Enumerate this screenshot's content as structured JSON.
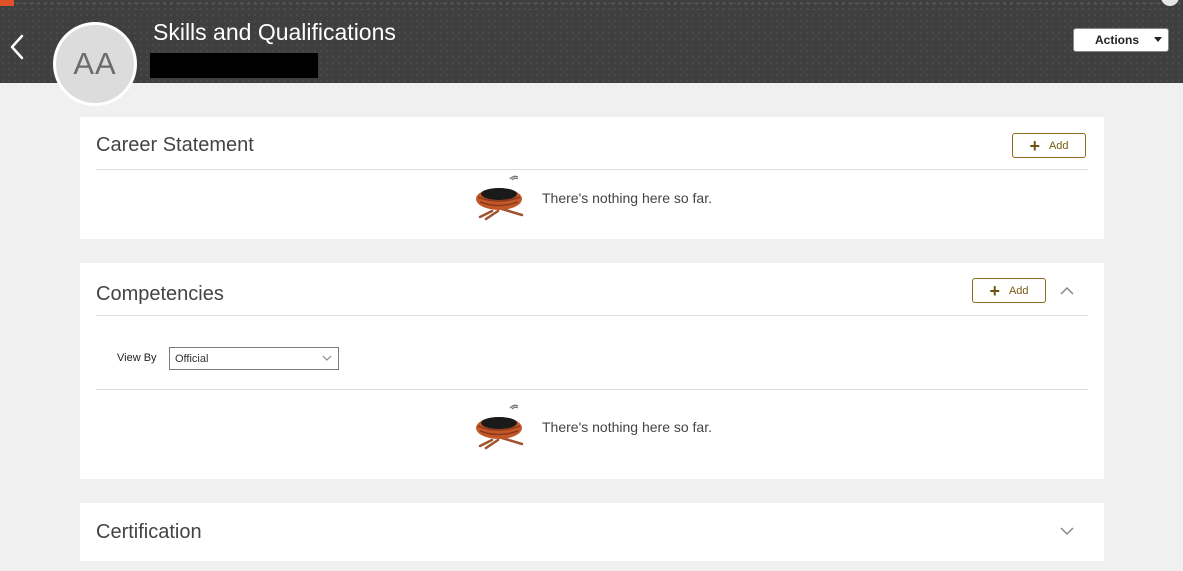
{
  "header": {
    "title": "Skills and Qualifications",
    "avatar_initials": "AA",
    "actions_label": "Actions",
    "back_icon": "chevron-left-icon"
  },
  "sections": {
    "career": {
      "title": "Career Statement",
      "add_label": "Add",
      "empty_text": "There's nothing here so far."
    },
    "competencies": {
      "title": "Competencies",
      "add_label": "Add",
      "view_by_label": "View By",
      "view_by_value": "Official",
      "empty_text": "There's nothing here so far.",
      "expanded": true
    },
    "certification": {
      "title": "Certification",
      "expanded": false
    }
  },
  "colors": {
    "header_bg": "#3f3f3f",
    "add_accent": "#8a6d1c",
    "page_bg": "#f0f0f0"
  }
}
